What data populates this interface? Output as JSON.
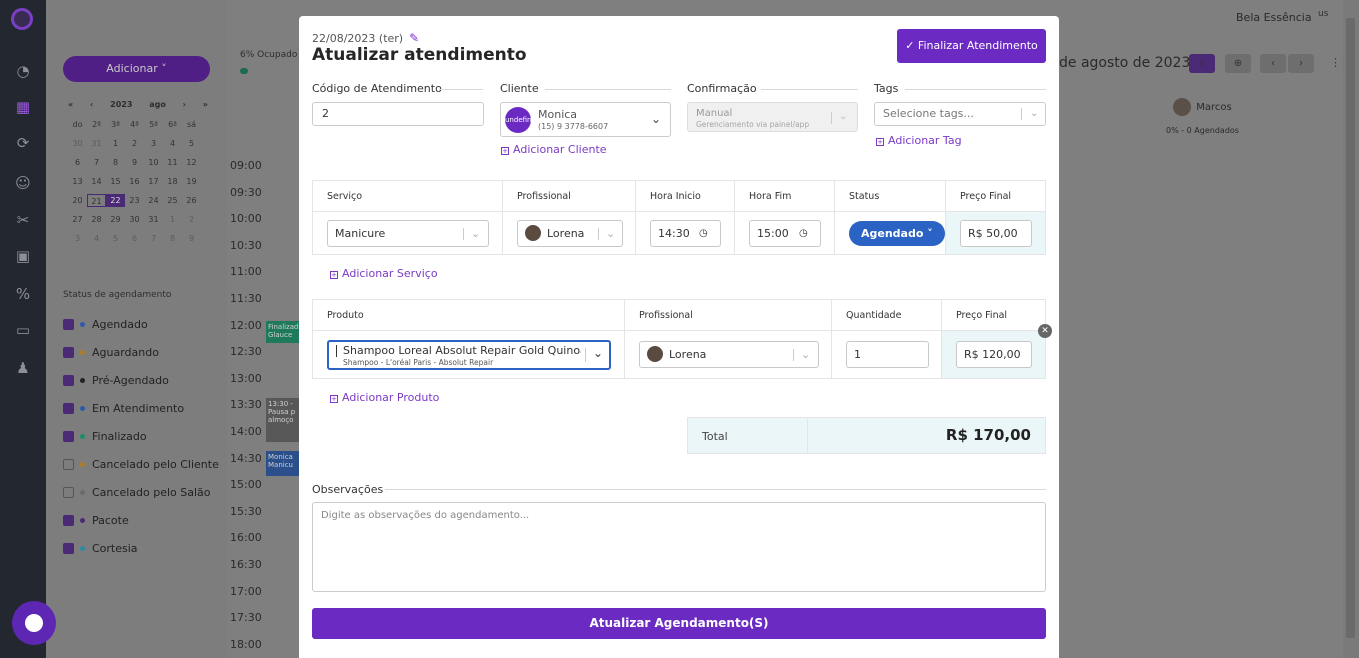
{
  "sidebar": {
    "icons": [
      "logo-icon",
      "chart-icon",
      "calendar-icon",
      "refresh-icon",
      "user-icon",
      "scissors-icon",
      "box-icon",
      "percent-icon",
      "inbox-icon",
      "users-icon"
    ]
  },
  "background": {
    "add_button": "Adicionar ˅",
    "mini_calendar": {
      "year": "2023",
      "month": "ago",
      "nav_prev2": "«",
      "nav_prev": "‹",
      "nav_next": "›",
      "nav_next2": "»",
      "weekdays": [
        "do",
        "2ª",
        "3ª",
        "4ª",
        "5ª",
        "6ª",
        "sá"
      ],
      "days": [
        "30",
        "31",
        "1",
        "2",
        "3",
        "4",
        "5",
        "6",
        "7",
        "8",
        "9",
        "10",
        "11",
        "12",
        "13",
        "14",
        "15",
        "16",
        "17",
        "18",
        "19",
        "20",
        "21",
        "22",
        "23",
        "24",
        "25",
        "26",
        "27",
        "28",
        "29",
        "30",
        "31",
        "1",
        "2",
        "3",
        "4",
        "5",
        "6",
        "7",
        "8",
        "9"
      ]
    },
    "status_title": "Status de agendamento",
    "statuses": [
      {
        "label": "Agendado",
        "checked": true,
        "color": "#2f5aa8"
      },
      {
        "label": "Aguardando",
        "checked": true,
        "color": "#b07a2a"
      },
      {
        "label": "Pré-Agendado",
        "checked": true,
        "color": "#222222"
      },
      {
        "label": "Em Atendimento",
        "checked": true,
        "color": "#2f5aa8"
      },
      {
        "label": "Finalizado",
        "checked": true,
        "color": "#1e8c6a"
      },
      {
        "label": "Cancelado pelo Cliente",
        "checked": false,
        "color": "#b07a2a"
      },
      {
        "label": "Cancelado pelo Salão",
        "checked": false,
        "color": "#6a6a6a"
      },
      {
        "label": "Pacote",
        "checked": true,
        "color": "#4b2a75"
      },
      {
        "label": "Cortesia",
        "checked": true,
        "color": "#2a8ca0"
      }
    ],
    "times": [
      "09:00",
      "09:30",
      "10:00",
      "10:30",
      "11:00",
      "11:30",
      "12:00",
      "12:30",
      "13:00",
      "13:30",
      "14:00",
      "14:30",
      "15:00",
      "15:30",
      "16:00",
      "16:30",
      "17:00",
      "17:30",
      "18:00"
    ],
    "occupancy": "6% Ocupado",
    "user_name": "Bela Essência",
    "user_avatar_alt": "us",
    "date_heading": "de agosto de 2023",
    "professional": {
      "name": "Marcos",
      "stats": "0% - 0 Agendados"
    },
    "appointments": [
      {
        "text": "Finalizado Glauce",
        "color": "#1f7a5c"
      },
      {
        "text": "13:30 - Pausa p almoço",
        "color": "#585858"
      },
      {
        "text": "Monica Manicu",
        "color": "#2b4f8a"
      }
    ]
  },
  "modal": {
    "date": "22/08/2023 (ter)",
    "title": "Atualizar atendimento",
    "finalize_button": "Finalizar Atendimento",
    "fields": {
      "code_label": "Código de Atendimento",
      "code_value": "2",
      "client_label": "Cliente",
      "client_avatar_text": "undefined",
      "client_name": "Monica",
      "client_phone": "(15) 9 3778-6607",
      "add_client": "Adicionar Cliente",
      "confirmation_label": "Confirmação",
      "confirmation_value": "Manual",
      "confirmation_sub": "Gerenciamento via painel/app",
      "tags_label": "Tags",
      "tags_placeholder": "Selecione tags...",
      "add_tag": "Adicionar Tag"
    },
    "services": {
      "headers": [
        "Serviço",
        "Profissional",
        "Hora Inicio",
        "Hora Fim",
        "Status",
        "Preço Final"
      ],
      "rows": [
        {
          "service": "Manicure",
          "professional": "Lorena",
          "start": "14:30",
          "end": "15:00",
          "status": "Agendado",
          "price": "R$ 50,00"
        }
      ],
      "add": "Adicionar Serviço"
    },
    "products": {
      "headers": [
        "Produto",
        "Profissional",
        "Quantidade",
        "Preço Final"
      ],
      "rows": [
        {
          "product": "Shampoo Loreal Absolut Repair Gold Quinoa + P",
          "product_sub": "Shampoo - L'oréal Paris - Absolut Repair",
          "professional": "Lorena",
          "quantity": "1",
          "price": "R$ 120,00"
        }
      ],
      "add": "Adicionar Produto"
    },
    "total_label": "Total",
    "total_value": "R$ 170,00",
    "observations_label": "Observações",
    "observations_placeholder": "Digite as observações do agendamento...",
    "submit_button": "Atualizar Agendamento(S)"
  }
}
